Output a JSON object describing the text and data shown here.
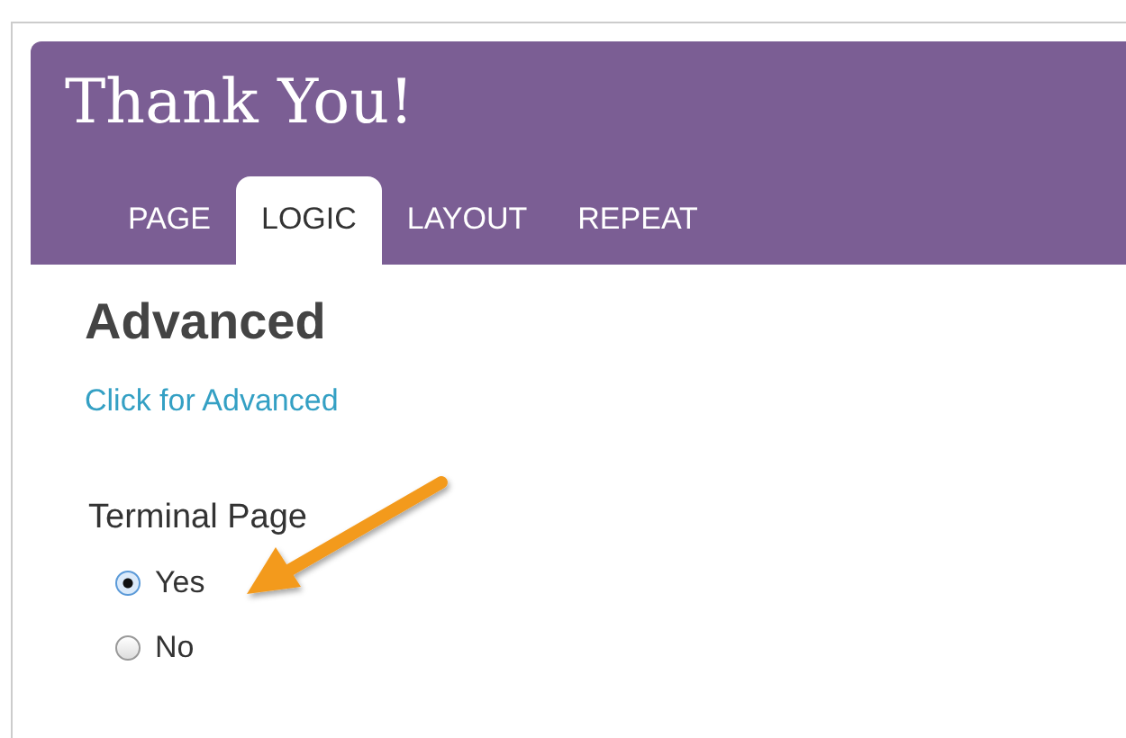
{
  "header": {
    "title": "Thank You!"
  },
  "tabs": [
    {
      "label": "PAGE",
      "selected": false
    },
    {
      "label": "LOGIC",
      "selected": true
    },
    {
      "label": "LAYOUT",
      "selected": false
    },
    {
      "label": "REPEAT",
      "selected": false
    }
  ],
  "section": {
    "heading": "Advanced",
    "link": "Click for Advanced"
  },
  "question": {
    "label": "Terminal Page",
    "options": [
      {
        "label": "Yes",
        "selected": true
      },
      {
        "label": "No",
        "selected": false
      }
    ]
  }
}
